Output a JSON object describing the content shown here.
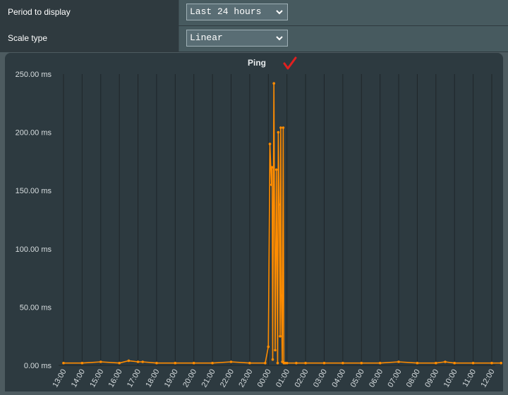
{
  "settings": {
    "period": {
      "label": "Period to display",
      "value": "Last 24 hours"
    },
    "scale": {
      "label": "Scale type",
      "value": "Linear"
    }
  },
  "icons": {
    "dropdown": "chevron-down-icon",
    "annotation": "checkmark-icon"
  },
  "colors": {
    "line": "#ff8c00",
    "panel": "#2d3a40",
    "grid": "#1f2629",
    "annotation": "#e02020"
  },
  "chart_data": {
    "type": "line",
    "title": "Ping",
    "ylim": [
      0,
      250
    ],
    "y_unit": "ms",
    "yticks": [
      "0.00 ms",
      "50.00 ms",
      "100.00 ms",
      "150.00 ms",
      "200.00 ms",
      "250.00 ms"
    ],
    "xticks": [
      "13:00",
      "14:00",
      "15:00",
      "16:00",
      "17:00",
      "18:00",
      "19:00",
      "20:00",
      "21:00",
      "22:00",
      "23:00",
      "00:00",
      "01:00",
      "02:00",
      "03:00",
      "04:00",
      "05:00",
      "06:00",
      "07:00",
      "08:00",
      "09:00",
      "10:00",
      "11:00",
      "12:00"
    ],
    "series": [
      {
        "x": [
          "13:00",
          "14:00",
          "15:00",
          "16:00",
          "16:30",
          "17:00",
          "17:15",
          "18:00",
          "19:00",
          "20:00",
          "21:00",
          "22:00",
          "23:00",
          "23:50",
          "00:00",
          "00:05",
          "00:10",
          "00:12",
          "00:14",
          "00:18",
          "00:22",
          "00:26",
          "00:30",
          "00:32",
          "00:35",
          "00:38",
          "00:40",
          "00:42",
          "00:45",
          "00:48",
          "00:50",
          "00:54",
          "01:00",
          "01:30",
          "02:00",
          "03:00",
          "04:00",
          "05:00",
          "06:00",
          "07:00",
          "08:00",
          "09:00",
          "09:30",
          "10:00",
          "11:00",
          "12:00",
          "12:30"
        ],
        "y": [
          2,
          2,
          3,
          2,
          4,
          3,
          3,
          2,
          2,
          2,
          2,
          3,
          2,
          2,
          16,
          190,
          155,
          170,
          5,
          242,
          13,
          168,
          2,
          200,
          138,
          25,
          204,
          60,
          3,
          204,
          2,
          2,
          2,
          2,
          2,
          2,
          2,
          2,
          2,
          3,
          2,
          2,
          3,
          2,
          2,
          2,
          2
        ]
      }
    ]
  }
}
